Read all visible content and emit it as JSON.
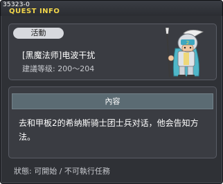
{
  "window": {
    "quest_code": "35323-0",
    "title": "QUEST INFO"
  },
  "header": {
    "badge": "活動",
    "quest_name": "[黑魔法师]电波干扰",
    "level_text": "建議等级: 200～204",
    "npc_icon": "armored-knight-npc"
  },
  "content": {
    "header": "內容",
    "text": "去和甲板2的希纳斯骑士团士兵对话，他会告知方法。"
  },
  "status": {
    "text": "狀態: 可開始 / 不可執行任務"
  },
  "colors": {
    "title": "#f2d64a",
    "window_bg": "#2f3136",
    "panel_bg": "#3a3c42",
    "content_header_bg": "#5b6b73"
  }
}
